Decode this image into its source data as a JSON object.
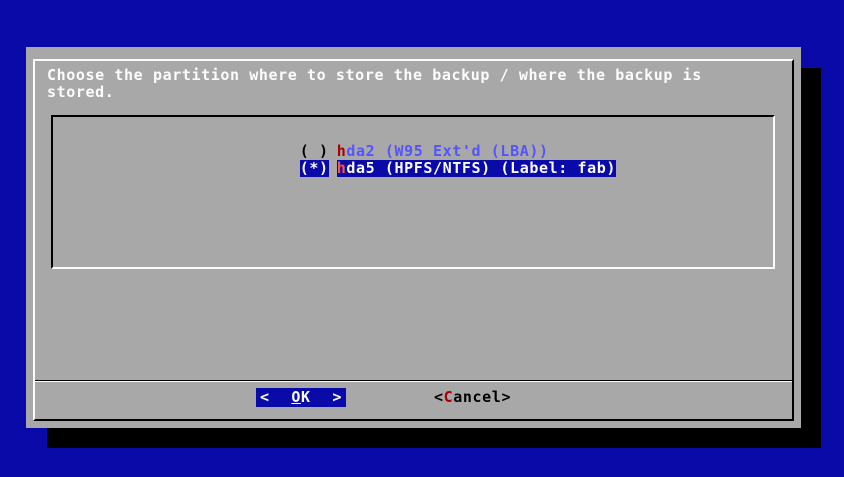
{
  "dialog": {
    "prompt": "Choose the partition where to store the backup / where the backup is\nstored.",
    "options": [
      {
        "radio": "( )",
        "hotkey": "h",
        "rest": "da2 (W95 Ext'd (LBA))",
        "selected": false
      },
      {
        "radio": "(*)",
        "hotkey": "h",
        "rest": "da5 (HPFS/NTFS) (Label: fab)",
        "selected": true
      }
    ],
    "buttons": {
      "ok": {
        "left": "<",
        "hotkey": "O",
        "rest": "K",
        "right": ">"
      },
      "cancel": {
        "open": "<",
        "hotkey": "C",
        "rest": "ancel",
        "close": ">"
      }
    }
  },
  "colors": {
    "screen_bg": "#0a0aa8",
    "dialog_bg": "#a8a8a8",
    "highlight_bg": "#0a0aa8",
    "item_text": "#5454fc",
    "hotkey": "#a80000"
  }
}
